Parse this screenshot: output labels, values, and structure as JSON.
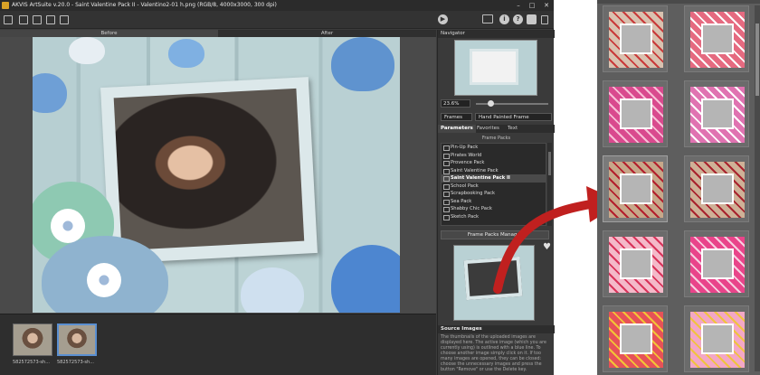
{
  "window": {
    "title": "AKVIS ArtSuite v.20.0 - Saint Valentine Pack II - Valentino2-01 h.png (RGB/8, 4000x3000, 300 dpi)",
    "minimize": "–",
    "maximize": "□",
    "close": "✕"
  },
  "toolbar": {
    "icons_left": [
      "open-icon",
      "save-icon",
      "save-as-icon",
      "print-icon",
      "share-icon"
    ],
    "icons_right": [
      "run-icon",
      "batch-icon",
      "info-icon",
      "help-icon",
      "settings-icon",
      "notification-icon"
    ],
    "info_glyph": "i",
    "help_glyph": "?",
    "run_glyph": "▶"
  },
  "view_tabs": {
    "before": "Before",
    "after": "After"
  },
  "navigator": {
    "title": "Navigator",
    "zoom": "23.6%"
  },
  "effect_select": {
    "category": "Frames",
    "frame": "Hand Painted Frame"
  },
  "param_tabs": {
    "parameters": "Parameters",
    "favorites": "Favorites",
    "text": "Text"
  },
  "frame_packs": {
    "title": "Frame Packs",
    "items": [
      {
        "label": "Pin-Up Pack",
        "selected": false
      },
      {
        "label": "Pirates World",
        "selected": false
      },
      {
        "label": "Provence Pack",
        "selected": false
      },
      {
        "label": "Saint Valentine Pack",
        "selected": false
      },
      {
        "label": "Saint Valentine Pack II",
        "selected": true
      },
      {
        "label": "School Pack",
        "selected": false
      },
      {
        "label": "Scrapbooking Pack",
        "selected": false
      },
      {
        "label": "Sea Pack",
        "selected": false
      },
      {
        "label": "Shabby Chic Pack",
        "selected": false
      },
      {
        "label": "Sketch Pack",
        "selected": false
      }
    ],
    "manager_button": "Frame Packs Manager"
  },
  "source_images": {
    "title": "Source Images",
    "text": "The thumbnails of the uploaded images are displayed here. The active image (which you are currently using) is outlined with a blue line. To choose another image simply click on it. If too many images are opened, they can be closed: choose the unnecessary images and press the button \"Remove\" or use the Delete key."
  },
  "filmstrip": {
    "thumbs": [
      {
        "label": "582572573-sh...",
        "selected": false
      },
      {
        "label": "582572573-sh...",
        "selected": true
      }
    ]
  },
  "colors": {
    "accent_arrow": "#c0201f",
    "selection_blue": "#5a8fd1"
  },
  "gallery": {
    "tiles": [
      {
        "name": "love-blocks-frame",
        "bg": "#d9c2b0",
        "accent": "#c93a3a",
        "selected": false
      },
      {
        "name": "gingham-hearts-frame",
        "bg": "#e56a80",
        "accent": "#ffffff",
        "selected": false
      },
      {
        "name": "pink-roses-frame",
        "bg": "#d94a8e",
        "accent": "#f7c0d6",
        "selected": false
      },
      {
        "name": "pink-love-frame",
        "bg": "#e073b1",
        "accent": "#ffffff",
        "selected": false
      },
      {
        "name": "scrabble-love-frame",
        "bg": "#c7a88a",
        "accent": "#b31f2d",
        "selected": true
      },
      {
        "name": "love-letters-frame",
        "bg": "#cfb197",
        "accent": "#a8232e",
        "selected": false
      },
      {
        "name": "floral-pink-frame",
        "bg": "#f4b9c9",
        "accent": "#d8335a",
        "selected": false
      },
      {
        "name": "pink-gradient-frame",
        "bg": "#e9448a",
        "accent": "#f6d0e0",
        "selected": false
      },
      {
        "name": "hearts-yellow-frame",
        "bg": "#e65258",
        "accent": "#f2c437",
        "selected": false
      },
      {
        "name": "polka-hearts-frame",
        "bg": "#f3a7c6",
        "accent": "#f0c43d",
        "selected": false
      }
    ]
  }
}
